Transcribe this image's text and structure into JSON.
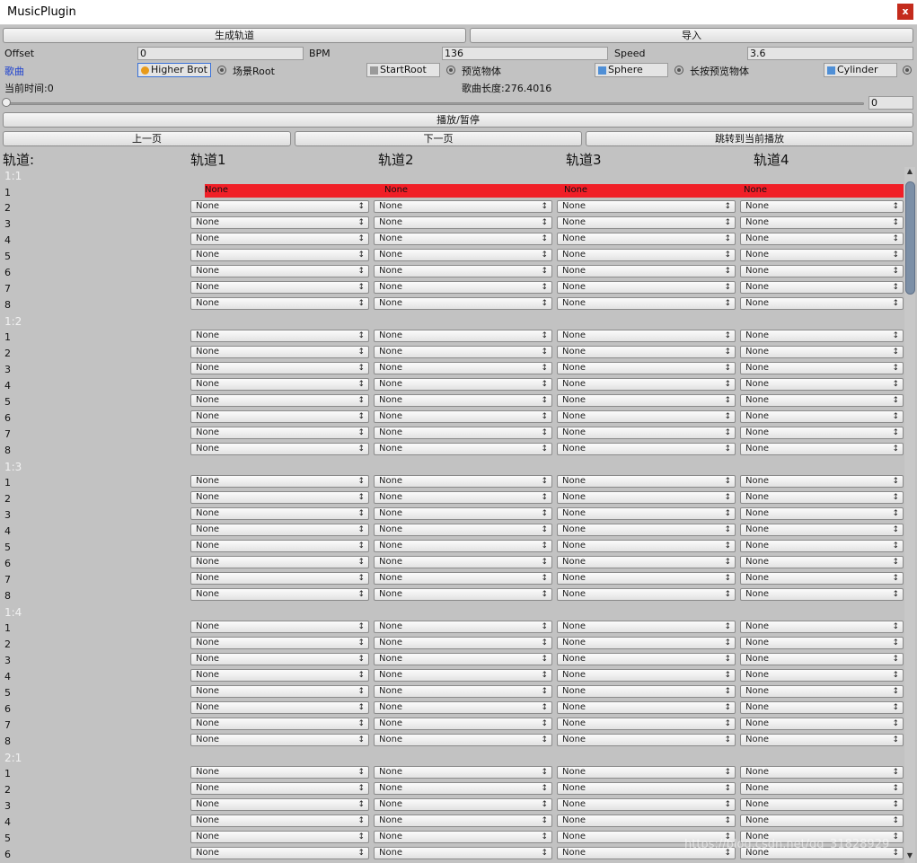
{
  "window": {
    "title": "MusicPlugin",
    "close_label": "x"
  },
  "toolbar": {
    "generate_label": "生成轨道",
    "import_label": "导入"
  },
  "settings": {
    "offset_label": "Offset",
    "offset_value": "0",
    "bpm_label": "BPM",
    "bpm_value": "136",
    "speed_label": "Speed",
    "speed_value": "3.6"
  },
  "objects": {
    "song_label": "歌曲",
    "song_value": "Higher Brot",
    "scene_root_label": "场景Root",
    "scene_root_value": "StartRoot",
    "preview_label": "预览物体",
    "preview_value": "Sphere",
    "long_preview_label": "长按预览物体",
    "long_preview_value": "Cylinder"
  },
  "playback": {
    "current_time": "当前时间:0",
    "song_length": "歌曲长度:276.4016",
    "slider_value": 0,
    "slider_display": "0",
    "play_pause_label": "播放/暂停"
  },
  "nav": {
    "prev_label": "上一页",
    "next_label": "下一页",
    "jump_label": "跳转到当前播放"
  },
  "tracks": {
    "header_label": "轨道:",
    "track_labels": [
      "轨道1",
      "轨道2",
      "轨道3",
      "轨道4"
    ]
  },
  "dropdown_value": "None",
  "highlight_color": "#f01f27",
  "beat_groups": [
    {
      "label": "1:1",
      "rows": [
        "1",
        "2",
        "3",
        "4",
        "5",
        "6",
        "7",
        "8"
      ],
      "highlighted_row": "1"
    },
    {
      "label": "1:2",
      "rows": [
        "1",
        "2",
        "3",
        "4",
        "5",
        "6",
        "7",
        "8"
      ]
    },
    {
      "label": "1:3",
      "rows": [
        "1",
        "2",
        "3",
        "4",
        "5",
        "6",
        "7",
        "8"
      ]
    },
    {
      "label": "1:4",
      "rows": [
        "1",
        "2",
        "3",
        "4",
        "5",
        "6",
        "7",
        "8"
      ]
    },
    {
      "label": "2:1",
      "rows": [
        "1",
        "2",
        "3",
        "4",
        "5",
        "6"
      ]
    }
  ],
  "watermark": "https://blog.csdn.net/qq_31828929",
  "scrollbar": {
    "up_icon": "triangle-up",
    "down_icon": "triangle-down"
  }
}
